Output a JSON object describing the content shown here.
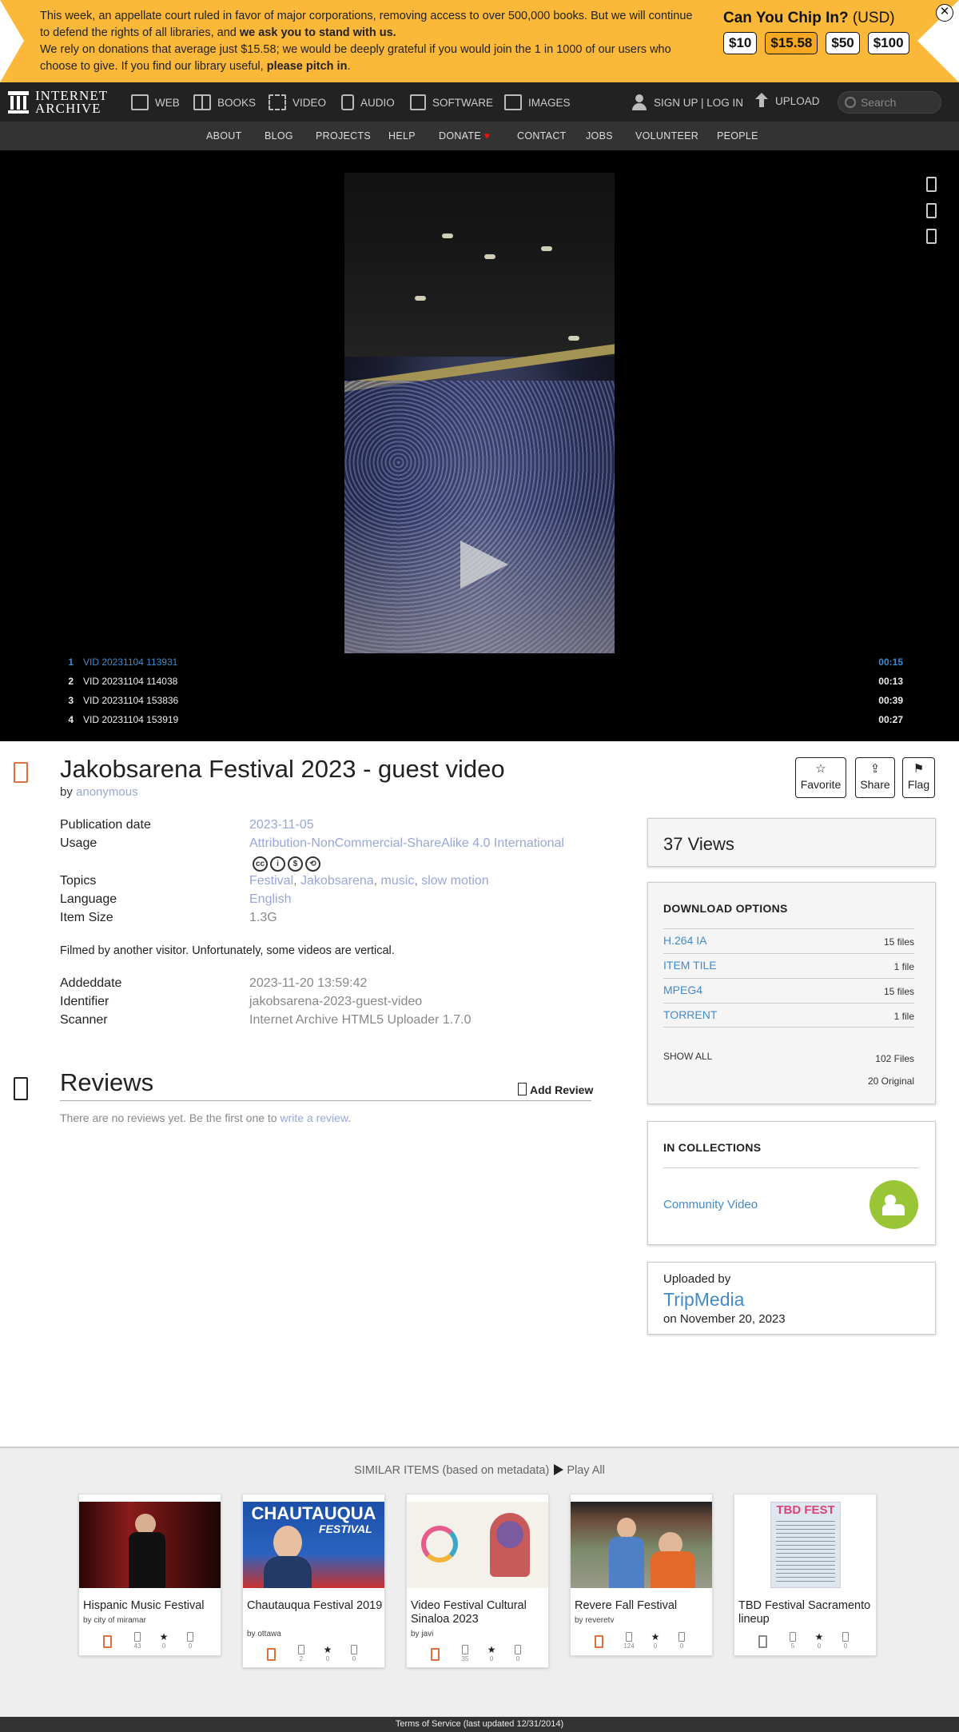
{
  "banner": {
    "message_1": "This week, an appellate court ruled in favor of major corporations, removing access to over 500,000 books. But we will continue to defend the rights of all libraries, and ",
    "message_1_bold": "we ask you to stand with us.",
    "message_2": "We rely on donations that average just $15.58; we would be deeply grateful if you would join the 1 in 1000 of our users who choose to give. If you find our library useful, ",
    "message_2_bold": "please pitch in",
    "message_2_end": ".",
    "chip_title": "Can You Chip In?",
    "chip_currency": "(USD)",
    "amounts": [
      "$10",
      "$15.58",
      "$50",
      "$100"
    ],
    "selected_amount": "$15.58",
    "close_icon": "close-icon",
    "accent_color": "#fcb839"
  },
  "nav": {
    "logo_line1": "INTERNET",
    "logo_line2": "ARCHIVE",
    "items": [
      "WEB",
      "BOOKS",
      "VIDEO",
      "AUDIO",
      "SOFTWARE",
      "IMAGES"
    ],
    "signup": "SIGN UP | LOG IN",
    "upload": "UPLOAD",
    "search_placeholder": "Search"
  },
  "subnav": {
    "items": [
      "ABOUT",
      "BLOG",
      "PROJECTS",
      "HELP",
      "DONATE",
      "CONTACT",
      "JOBS",
      "VOLUNTEER",
      "PEOPLE"
    ]
  },
  "playlist": [
    {
      "num": "1",
      "title": "VID 20231104 113931",
      "duration": "00:15"
    },
    {
      "num": "2",
      "title": "VID 20231104 114038",
      "duration": "00:13"
    },
    {
      "num": "3",
      "title": "VID 20231104 153836",
      "duration": "00:39"
    },
    {
      "num": "4",
      "title": "VID 20231104 153919",
      "duration": "00:27"
    }
  ],
  "item": {
    "title": "Jakobsarena Festival 2023 - guest video",
    "by_label": "by",
    "author": "anonymous",
    "actions": [
      "Favorite",
      "Share",
      "Flag"
    ],
    "metadata": {
      "publication_date_label": "Publication date",
      "publication_date": "2023-11-05",
      "usage_label": "Usage",
      "usage": "Attribution-NonCommercial-ShareAlike 4.0 International",
      "topics_label": "Topics",
      "topics": [
        "Festival",
        "Jakobsarena",
        "music",
        "slow motion"
      ],
      "language_label": "Language",
      "language": "English",
      "item_size_label": "Item Size",
      "item_size": "1.3G"
    },
    "description": "Filmed by another visitor. Unfortunately, some videos are vertical.",
    "more_metadata": {
      "addeddate_label": "Addeddate",
      "addeddate": "2023-11-20 13:59:42",
      "identifier_label": "Identifier",
      "identifier": "jakobsarena-2023-guest-video",
      "scanner_label": "Scanner",
      "scanner": "Internet Archive HTML5 Uploader 1.7.0"
    }
  },
  "reviews": {
    "title": "Reviews",
    "add_label": "Add Review",
    "empty_text": "There are no reviews yet. Be the first one to ",
    "empty_link": "write a review",
    "empty_end": "."
  },
  "sidebar": {
    "views": "37 Views",
    "download_title": "DOWNLOAD OPTIONS",
    "downloads": [
      {
        "format": "H.264 IA",
        "count": "15 files"
      },
      {
        "format": "ITEM TILE",
        "count": "1 file"
      },
      {
        "format": "MPEG4",
        "count": "15 files"
      },
      {
        "format": "TORRENT",
        "count": "1 file"
      }
    ],
    "show_all": "SHOW ALL",
    "total_files": "102 Files",
    "original_files": "20 Original",
    "collections_title": "IN COLLECTIONS",
    "collection": "Community Video",
    "uploaded_by_label": "Uploaded by",
    "uploader": "TripMedia",
    "uploaded_on": "on November 20, 2023"
  },
  "similar": {
    "heading": "SIMILAR ITEMS (based on metadata)",
    "play_all": "Play All",
    "items": [
      {
        "title": "Hispanic Music Festival",
        "by": "by city of miramar",
        "views": "43",
        "favs": "0",
        "reviews": "0"
      },
      {
        "title": "Chautauqua Festival 2019",
        "by": "by ottawa",
        "views": "2",
        "favs": "0",
        "reviews": "0"
      },
      {
        "title": "Video Festival Cultural Sinaloa 2023",
        "by": "by javi",
        "views": "35",
        "favs": "0",
        "reviews": "0"
      },
      {
        "title": "Revere Fall Festival",
        "by": "by reveretv",
        "views": "124",
        "favs": "0",
        "reviews": "0"
      },
      {
        "title": "TBD Festival Sacramento lineup",
        "by": "",
        "views": "5",
        "favs": "0",
        "reviews": "0"
      }
    ],
    "thumb_text_2": "CHAUTAUQUA",
    "thumb_text_2b": "FESTIVAL",
    "thumb_text_5": "TBD FEST"
  },
  "footer": {
    "text": "Terms of Service (last updated 12/31/2014)"
  }
}
